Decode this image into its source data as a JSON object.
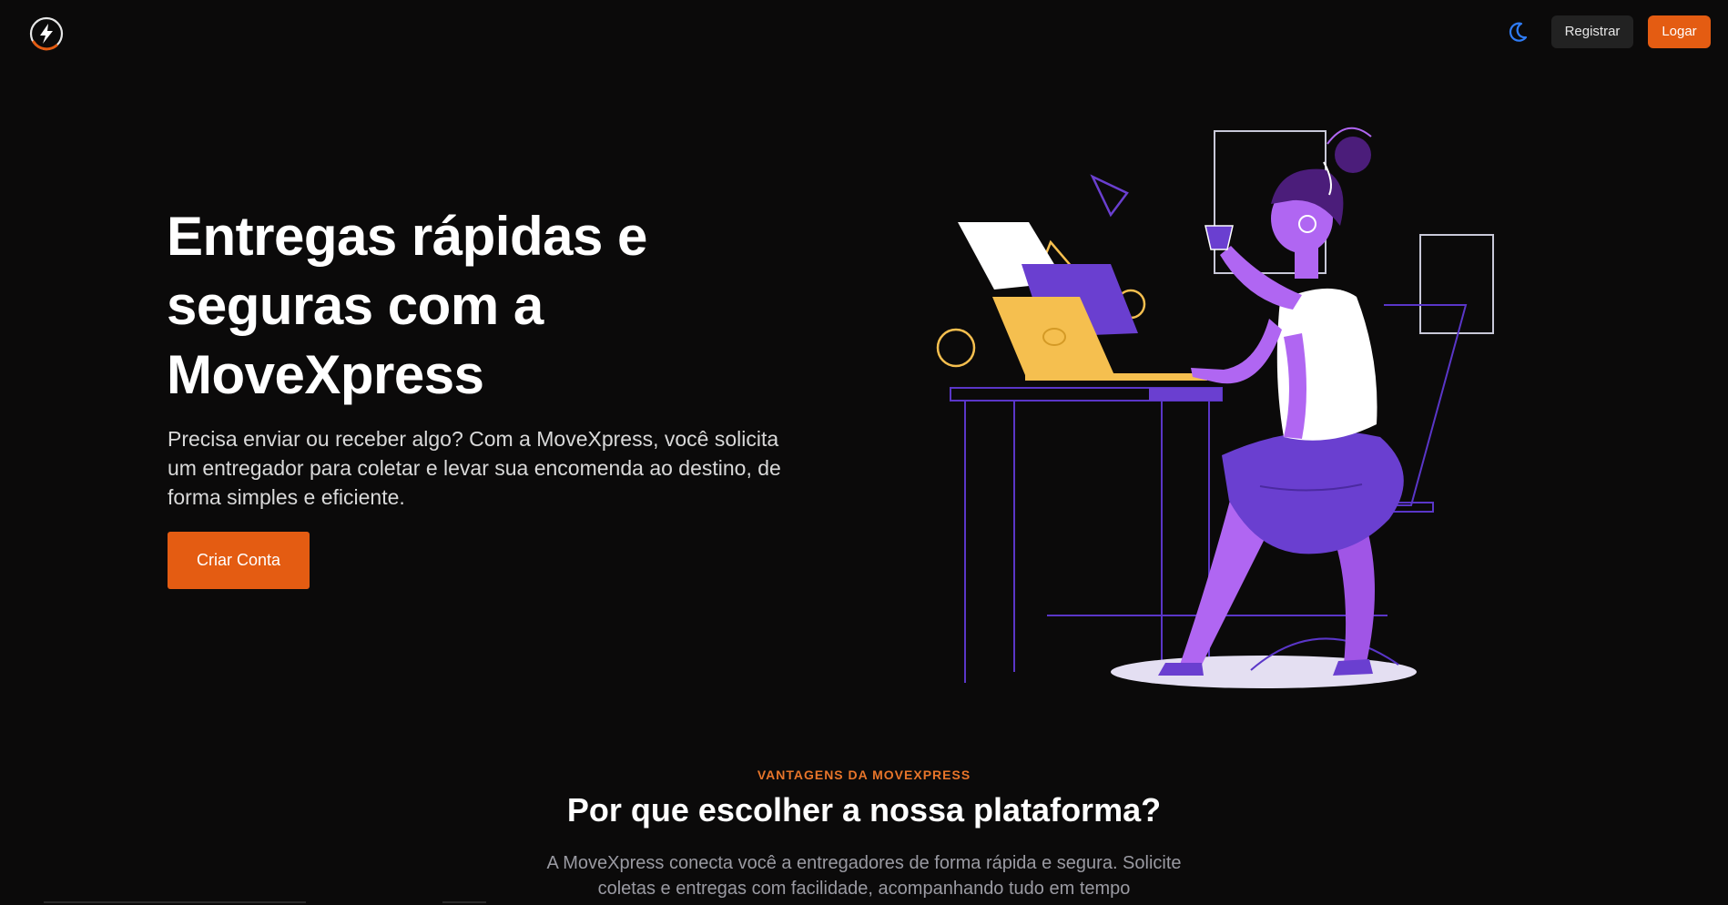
{
  "header": {
    "logo_icon": "lightning-bolt-icon",
    "theme_toggle_icon": "moon-icon",
    "register_label": "Registrar",
    "login_label": "Logar"
  },
  "hero": {
    "title": "Entregas rápidas e seguras com a MoveXpress",
    "description": "Precisa enviar ou receber algo? Com a MoveXpress, você solicita um entregador para coletar e levar sua encomenda ao destino, de forma simples e eficiente.",
    "cta_label": "Criar Conta",
    "illustration": "woman-at-desk-with-laptop-illustration"
  },
  "features": {
    "eyebrow": "VANTAGENS DA MOVEXPRESS",
    "title": "Por que escolher a nossa plataforma?",
    "description": "A MoveXpress conecta você a entregadores de forma rápida e segura. Solicite coletas e entregas com facilidade, acompanhando tudo em tempo"
  },
  "colors": {
    "background": "#0b0a0a",
    "accent": "#e45c12",
    "eyebrow": "#e8752a",
    "illustration_purple": "#6a3fd0",
    "illustration_violet": "#b066f2",
    "illustration_yellow": "#f5bf4f"
  }
}
